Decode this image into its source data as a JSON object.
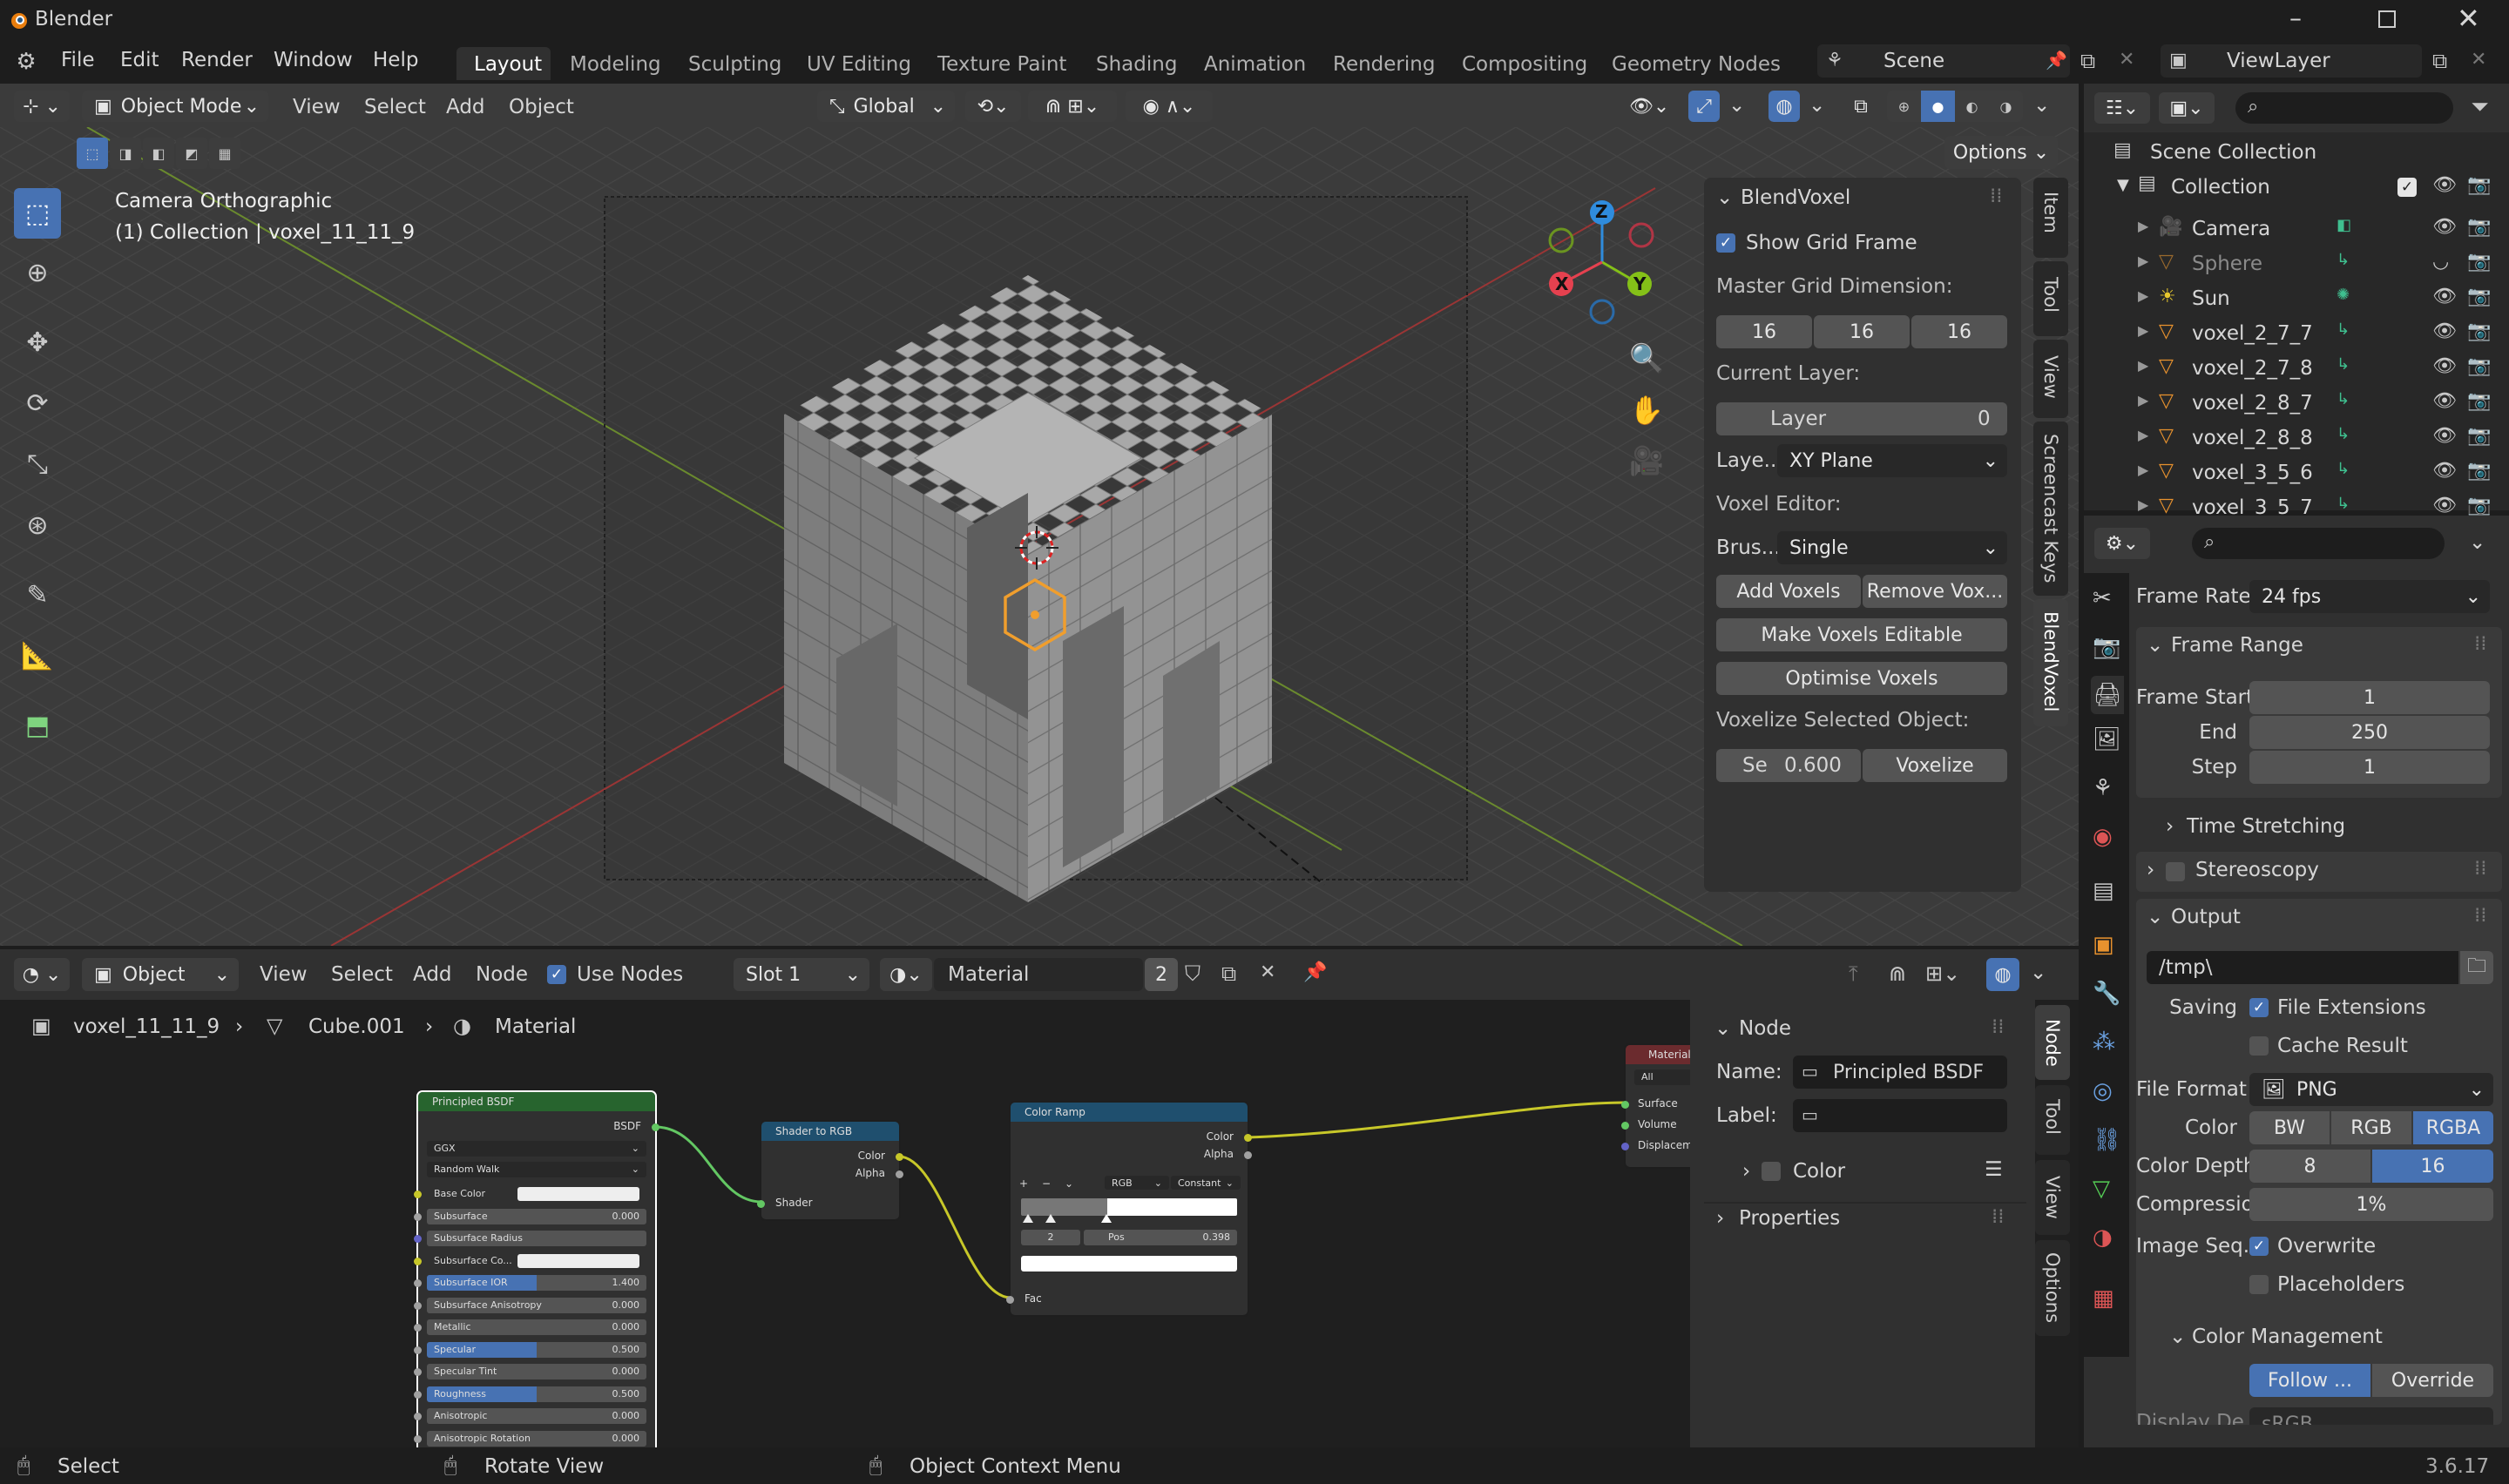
{
  "window": {
    "app_name": "Blender",
    "version": "3.6.17"
  },
  "menubar": {
    "items": [
      "File",
      "Edit",
      "Render",
      "Window",
      "Help"
    ]
  },
  "workspaces": {
    "tabs": [
      "Layout",
      "Modeling",
      "Sculpting",
      "UV Editing",
      "Texture Paint",
      "Shading",
      "Animation",
      "Rendering",
      "Compositing",
      "Geometry Nodes"
    ],
    "active": "Layout"
  },
  "scene": {
    "name": "Scene",
    "view_layer": "ViewLayer"
  },
  "viewport": {
    "mode": "Object Mode",
    "menus": [
      "View",
      "Select",
      "Add",
      "Object"
    ],
    "transform": "Global",
    "options": "Options",
    "camera_info": "Camera Orthographic",
    "collection_info": "(1) Collection | voxel_11_11_9",
    "side_tabs": [
      "Item",
      "Tool",
      "View",
      "Screencast Keys",
      "BlendVoxel"
    ],
    "gizmo": {
      "x": "X",
      "y": "Y",
      "z": "Z"
    }
  },
  "blendvoxel": {
    "title": "BlendVoxel",
    "show_grid": "Show Grid Frame",
    "master_grid_label": "Master Grid Dimension:",
    "grid": [
      "16",
      "16",
      "16"
    ],
    "current_layer_label": "Current Layer:",
    "layer_name": "Layer",
    "layer_value": "0",
    "layer_plane_label": "Laye...",
    "layer_plane": "XY Plane",
    "voxel_editor_label": "Voxel Editor:",
    "brush_label": "Brus...",
    "brush": "Single",
    "add_voxels": "Add Voxels",
    "remove_voxels": "Remove Vox...",
    "make_editable": "Make Voxels Editable",
    "optimise": "Optimise Voxels",
    "voxelize_label": "Voxelize Selected Object:",
    "size_label": "Se",
    "size_value": "0.600",
    "voxelize": "Voxelize"
  },
  "outliner": {
    "scene_collection": "Scene Collection",
    "collection": "Collection",
    "items": [
      "Camera",
      "Sphere",
      "Sun",
      "voxel_2_7_7",
      "voxel_2_7_8",
      "voxel_2_8_7",
      "voxel_2_8_8",
      "voxel_3_5_6",
      "voxel_3_5_7"
    ]
  },
  "properties": {
    "frame_rate_label": "Frame Rate",
    "frame_rate": "24 fps",
    "frame_range": "Frame Range",
    "frame_start_label": "Frame Start",
    "frame_start": "1",
    "end_label": "End",
    "end": "250",
    "step_label": "Step",
    "step": "1",
    "time_stretching": "Time Stretching",
    "stereoscopy": "Stereoscopy",
    "output": "Output",
    "path": "/tmp\\",
    "saving_label": "Saving",
    "file_extensions": "File Extensions",
    "cache_result": "Cache Result",
    "file_format_label": "File Format",
    "file_format": "PNG",
    "color_label": "Color",
    "color_opts": [
      "BW",
      "RGB",
      "RGBA"
    ],
    "color_depth_label": "Color Depth",
    "depth_opts": [
      "8",
      "16"
    ],
    "compression_label": "Compression",
    "compression": "1%",
    "image_seq_label": "Image Seq...",
    "overwrite": "Overwrite",
    "placeholders": "Placeholders",
    "color_management": "Color Management",
    "follow": "Follow ...",
    "override": "Override",
    "display_label": "Display De...",
    "display_value": "sRGB"
  },
  "node_editor": {
    "type": "Object",
    "menus": [
      "View",
      "Select",
      "Add",
      "Node"
    ],
    "use_nodes": "Use Nodes",
    "slot": "Slot 1",
    "material": "Material",
    "users": "2",
    "breadcrumb": [
      "voxel_11_11_9",
      "Cube.001",
      "Material"
    ],
    "side_tabs": [
      "Node",
      "Tool",
      "View",
      "Options"
    ],
    "panel": {
      "node": "Node",
      "name_label": "Name:",
      "name": "Principled BSDF",
      "label_label": "Label:",
      "color": "Color",
      "properties": "Properties"
    },
    "bsdf": {
      "title": "Principled BSDF",
      "out": "BSDF",
      "dist": "GGX",
      "sss": "Random Walk",
      "rows": [
        {
          "label": "Base Color",
          "value": ""
        },
        {
          "label": "Subsurface",
          "value": "0.000"
        },
        {
          "label": "Subsurface Radius",
          "value": ""
        },
        {
          "label": "Subsurface Co...",
          "value": ""
        },
        {
          "label": "Subsurface IOR",
          "value": "1.400"
        },
        {
          "label": "Subsurface Anisotropy",
          "value": "0.000"
        },
        {
          "label": "Metallic",
          "value": "0.000"
        },
        {
          "label": "Specular",
          "value": "0.500"
        },
        {
          "label": "Specular Tint",
          "value": "0.000"
        },
        {
          "label": "Roughness",
          "value": "0.500"
        },
        {
          "label": "Anisotropic",
          "value": "0.000"
        },
        {
          "label": "Anisotropic Rotation",
          "value": "0.000"
        }
      ]
    },
    "shader_to_rgb": {
      "title": "Shader to RGB",
      "color": "Color",
      "alpha": "Alpha",
      "shader": "Shader"
    },
    "color_ramp": {
      "title": "Color Ramp",
      "color": "Color",
      "alpha": "Alpha",
      "mode": "RGB",
      "interp": "Constant",
      "index": "2",
      "pos_label": "Pos",
      "pos": "0.398",
      "fac": "Fac"
    },
    "material_output": {
      "title": "Material Output",
      "target": "All",
      "surface": "Surface",
      "volume": "Volume",
      "displacement": "Displacement"
    }
  },
  "statusbar": {
    "select": "Select",
    "rotate": "Rotate View",
    "context": "Object Context Menu"
  }
}
